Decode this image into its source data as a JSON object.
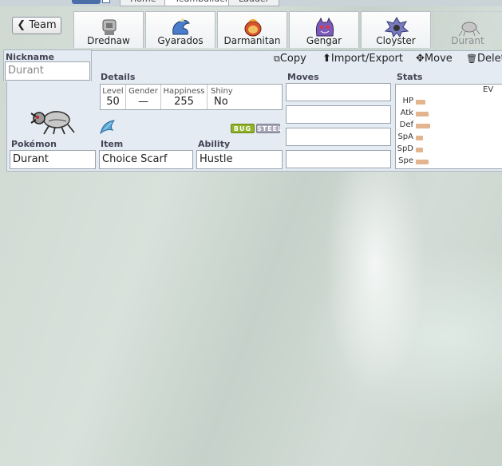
{
  "nav": {
    "tabs": [
      "Home",
      "Teambuilder",
      "Ladder"
    ]
  },
  "team_button": {
    "label": "Team"
  },
  "slots": [
    {
      "name": "Drednaw",
      "icon": "drednaw-sprite"
    },
    {
      "name": "Gyarados",
      "icon": "gyarados-sprite"
    },
    {
      "name": "Darmanitan",
      "icon": "darmanitan-sprite"
    },
    {
      "name": "Gengar",
      "icon": "gengar-sprite"
    },
    {
      "name": "Cloyster",
      "icon": "cloyster-sprite"
    },
    {
      "name": "Durant",
      "icon": "durant-sprite"
    }
  ],
  "nickname": {
    "label": "Nickname",
    "placeholder": "Durant"
  },
  "toolbar": {
    "copy": "Copy",
    "import_export": "Import/Export",
    "move": "Move",
    "delete": "Delete"
  },
  "details": {
    "label": "Details",
    "level_key": "Level",
    "level": "50",
    "gender_key": "Gender",
    "gender": "—",
    "happiness_key": "Happiness",
    "happiness": "255",
    "shiny_key": "Shiny",
    "shiny": "No"
  },
  "types": [
    {
      "name": "BUG",
      "color": "#8fb22a"
    },
    {
      "name": "STEEL",
      "color": "#a6a6b8"
    }
  ],
  "pokemon": {
    "label": "Pokémon",
    "value": "Durant"
  },
  "item": {
    "label": "Item",
    "value": "Choice Scarf"
  },
  "ability": {
    "label": "Ability",
    "value": "Hustle"
  },
  "moves": {
    "label": "Moves",
    "slots": [
      "",
      "",
      "",
      ""
    ]
  },
  "stats": {
    "label": "Stats",
    "ev_label": "EV",
    "rows": [
      {
        "name": "HP",
        "bar": 0.26
      },
      {
        "name": "Atk",
        "bar": 0.34
      },
      {
        "name": "Def",
        "bar": 0.38
      },
      {
        "name": "SpA",
        "bar": 0.18
      },
      {
        "name": "SpD",
        "bar": 0.18
      },
      {
        "name": "Spe",
        "bar": 0.34
      }
    ]
  },
  "colors": {
    "accent": "#e3b58f",
    "panel": "#e4ebf3"
  }
}
